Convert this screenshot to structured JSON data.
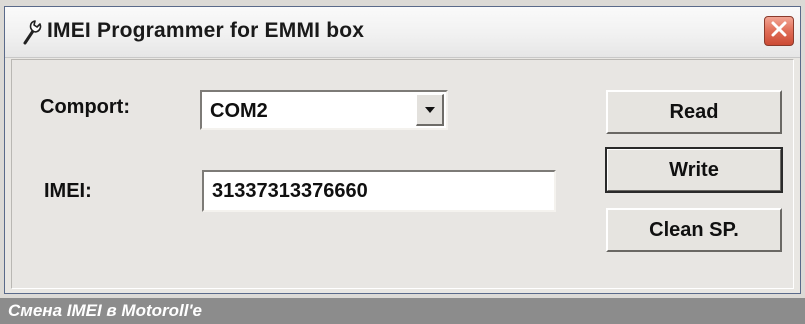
{
  "window": {
    "title": "IMEI Programmer for EMMI box",
    "icon": "wrench-icon",
    "close_icon": "close-icon",
    "close_color": "#d9573f"
  },
  "form": {
    "comport_label": "Comport:",
    "comport_value": "COM2",
    "imei_label": "IMEI:",
    "imei_value": "31337313376660"
  },
  "buttons": {
    "read": "Read",
    "write": "Write",
    "clean": "Clean SP."
  },
  "caption": "Смена IMEI в Motoroll'e"
}
